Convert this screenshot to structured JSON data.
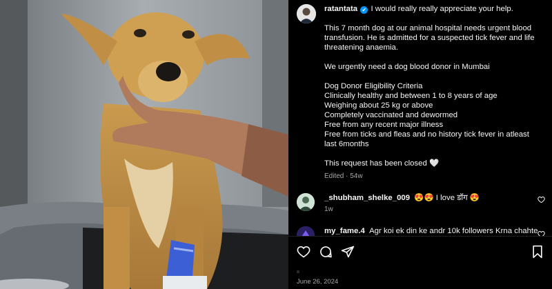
{
  "post": {
    "username": "ratantata",
    "verified_glyph": "✔",
    "lines": [
      "I would really really appreciate your help.",
      "",
      "This 7 month dog at our animal hospital needs urgent blood",
      "transfusion. He is admitted for a suspected tick fever and life",
      "threatening anaemia.",
      "",
      "We urgently need a dog blood donor in Mumbai",
      "",
      "Dog Donor Eligibility Criteria",
      "Clinically healthy and between 1 to 8 years of age",
      "Weighing about 25 kg or above",
      "Completely vaccinated and dewormed",
      "Free from any recent major illness",
      "Free from ticks and fleas and no history tick fever in atleast",
      "last 6months",
      "",
      "This request has been closed 🤍"
    ],
    "meta": "Edited · 54w"
  },
  "comments": [
    {
      "username": "_shubham_shelke_009",
      "text": "😍😍 I love डॉग 😍",
      "time": "1w"
    },
    {
      "username": "my_fame.4",
      "text": "Agr koi ek din ke andr 10k followers Krna chahte",
      "time": ""
    }
  ],
  "actions": {
    "like_icon": "heart-outline",
    "comment_icon": "speech-bubble",
    "share_icon": "paper-plane",
    "save_icon": "bookmark"
  },
  "footer": {
    "date": "June 26, 2024"
  },
  "colors": {
    "verified": "#0095f6",
    "background": "#000000",
    "muted": "#a8a8a8"
  }
}
